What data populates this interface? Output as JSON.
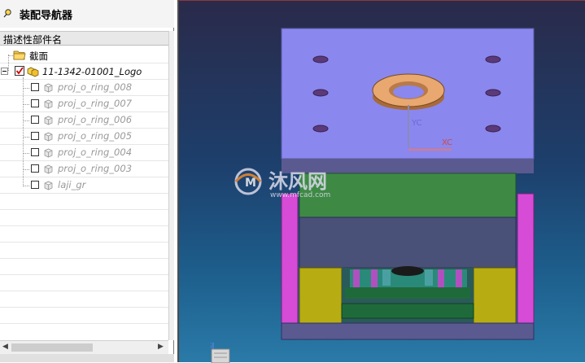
{
  "navigator": {
    "title": "装配导航器",
    "column_header": "描述性部件名",
    "items": [
      {
        "label": "截面"
      },
      {
        "label": "11-1342-01001_Logo"
      },
      {
        "label": "proj_o_ring_008"
      },
      {
        "label": "proj_o_ring_007"
      },
      {
        "label": "proj_o_ring_006"
      },
      {
        "label": "proj_o_ring_005"
      },
      {
        "label": "proj_o_ring_004"
      },
      {
        "label": "proj_o_ring_003"
      },
      {
        "label": "laji_gr"
      }
    ]
  },
  "viewport": {
    "axis_y": "YC",
    "axis_x": "XC",
    "axis_z": "Z",
    "watermark_text": "沐风网",
    "watermark_url": "www.mfcad.com"
  },
  "colors": {
    "plate_top": "#8a87ee",
    "plate_green": "#3e8a45",
    "plate_slate": "#4a5178",
    "pillar": "#d64cd6",
    "block_yellow": "#b7ad12",
    "ring": "#e8a870"
  }
}
